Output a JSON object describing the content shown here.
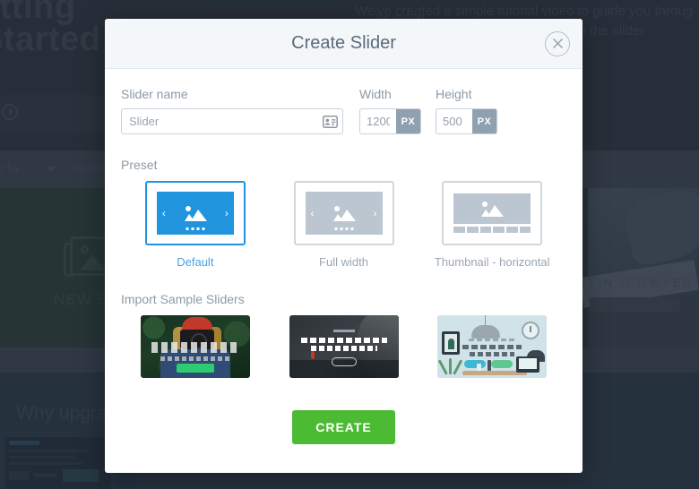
{
  "background": {
    "hero_title": "Started",
    "hero_title_line1": "etting",
    "hero_paragraph": "We've created a simple tutorial video to guide you throug",
    "hero_paragraph_2": "uck with the slider",
    "tab_label": "The next tab",
    "toolbar_sort_label": "der by",
    "toolbar_select_label": "Select",
    "new_slider_label": "NEW S",
    "upgrade_title": "Why upgra",
    "person_name": "RTIN O'DWYER"
  },
  "modal": {
    "title": "Create Slider",
    "close_icon": "close-icon",
    "fields": {
      "name_label": "Slider name",
      "name_value": "Slider",
      "name_placeholder": "Slider",
      "name_icon": "id-card-icon",
      "width_label": "Width",
      "width_value": "1200",
      "width_unit": "PX",
      "height_label": "Height",
      "height_value": "500",
      "height_unit": "PX"
    },
    "preset": {
      "title": "Preset",
      "selected": "Default",
      "items": [
        {
          "label": "Default",
          "selected": true,
          "icon": "slider-preview-icon"
        },
        {
          "label": "Full width",
          "selected": false,
          "icon": "slider-preview-icon"
        },
        {
          "label": "Thumbnail - horizontal",
          "selected": false,
          "icon": "thumbnail-preview-icon"
        }
      ]
    },
    "samples": {
      "title": "Import Sample Sliders",
      "items": [
        {
          "name": "photographer-sample"
        },
        {
          "name": "lighthouse-sample"
        },
        {
          "name": "studio-sample"
        }
      ]
    },
    "create_button": "CREATE"
  },
  "colors": {
    "accent_blue": "#2095dd",
    "create_green": "#4cbb33",
    "header_bg": "#f4f7fa",
    "label_gray": "#8d9aa6",
    "unit_gray": "#8fa0ae"
  }
}
